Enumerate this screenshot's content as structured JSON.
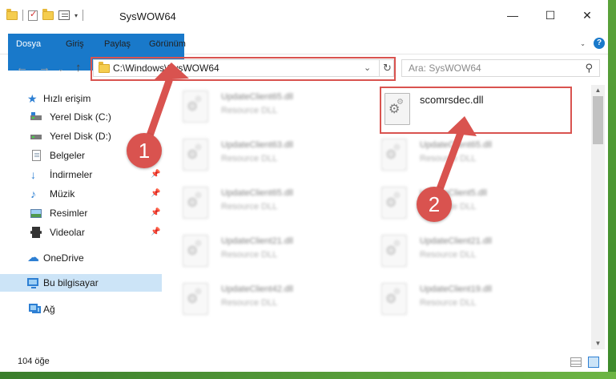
{
  "window": {
    "title": "SysWOW64",
    "controls": {
      "minimize": "—",
      "maximize": "☐",
      "close": "✕"
    }
  },
  "ribbon": {
    "tabs": [
      "Dosya",
      "Giriş",
      "Paylaş",
      "Görünüm"
    ],
    "expand_icon": "chevron-down-icon",
    "help": "?"
  },
  "address": {
    "path": "C:\\Windows\\SysWOW64",
    "search_placeholder": "Ara: SysWOW64"
  },
  "sidebar": {
    "items": [
      {
        "label": "Hızlı erişim",
        "icon": "star-icon"
      },
      {
        "label": "Yerel Disk (C:)",
        "icon": "drive-icon"
      },
      {
        "label": "Yerel Disk (D:)",
        "icon": "drive-icon"
      },
      {
        "label": "Belgeler",
        "icon": "document-icon"
      },
      {
        "label": "İndirmeler",
        "icon": "download-icon"
      },
      {
        "label": "Müzik",
        "icon": "music-icon"
      },
      {
        "label": "Resimler",
        "icon": "pictures-icon"
      },
      {
        "label": "Videolar",
        "icon": "video-icon"
      },
      {
        "label": "OneDrive",
        "icon": "cloud-icon"
      },
      {
        "label": "Bu bilgisayar",
        "icon": "computer-icon"
      },
      {
        "label": "Ağ",
        "icon": "network-icon"
      }
    ]
  },
  "files": {
    "main": {
      "name": "scomrsdec.dll"
    },
    "left_column": [
      {
        "name": "UpdateClient65.dll",
        "type": "Resource DLL"
      },
      {
        "name": "UpdateClient63.dll",
        "type": "Resource DLL"
      },
      {
        "name": "UpdateClient65.dll",
        "type": "Resource DLL"
      },
      {
        "name": "UpdateClient21.dll",
        "type": "Resource DLL"
      },
      {
        "name": "UpdateClient42.dll",
        "type": "Resource DLL"
      }
    ],
    "right_column": [
      {
        "name": "UpdateClient65.dll",
        "type": "Resource DLL"
      },
      {
        "name": "UpdateClient5.dll",
        "type": "Resource DLL"
      },
      {
        "name": "UpdateClient21.dll",
        "type": "Resource DLL"
      },
      {
        "name": "UpdateClient19.dll",
        "type": "Resource DLL"
      }
    ]
  },
  "status": {
    "item_count": "104 öğe"
  },
  "callouts": {
    "step1": "1",
    "step2": "2"
  },
  "colors": {
    "accent": "#1979ca",
    "highlight": "#d9534f",
    "selected": "#cce4f7"
  }
}
